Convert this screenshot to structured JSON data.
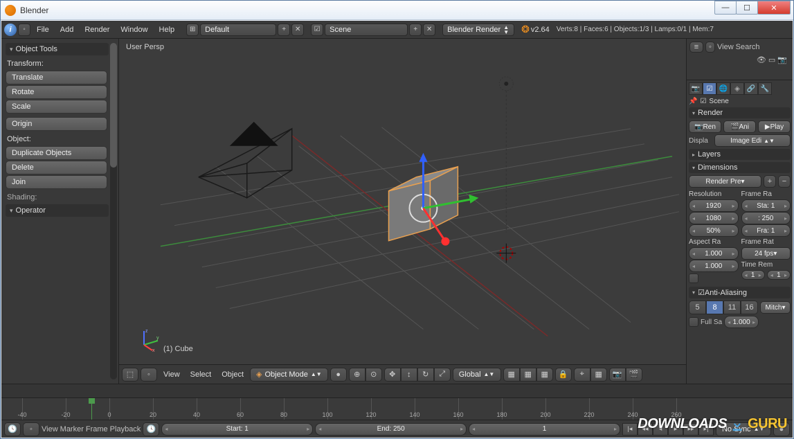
{
  "window": {
    "title": "Blender"
  },
  "menubar": {
    "items": [
      "File",
      "Add",
      "Render",
      "Window",
      "Help"
    ],
    "layout_value": "Default",
    "scene_value": "Scene",
    "engine_value": "Blender Render",
    "version": "v2.64",
    "stats": "Verts:8 | Faces:6 | Objects:1/3 | Lamps:0/1 | Mem:7"
  },
  "toolbox": {
    "header": "Object Tools",
    "transform_label": "Transform:",
    "transform_buttons": [
      "Translate",
      "Rotate",
      "Scale"
    ],
    "origin_button": "Origin",
    "object_label": "Object:",
    "object_buttons": [
      "Duplicate Objects",
      "Delete",
      "Join"
    ],
    "shading_label": "Shading:",
    "operator_header": "Operator"
  },
  "viewport": {
    "persp_label": "User Persp",
    "object_label": "(1) Cube",
    "header": {
      "menus": [
        "View",
        "Select",
        "Object"
      ],
      "mode": "Object Mode",
      "orientation": "Global"
    }
  },
  "outliner": {
    "menus": [
      "View",
      "Search"
    ]
  },
  "props": {
    "context_label": "Scene",
    "render_header": "Render",
    "render_buttons": [
      "Ren",
      "Ani",
      "Play"
    ],
    "display_label": "Displa",
    "display_value": "Image Edi",
    "layers_header": "Layers",
    "dimensions_header": "Dimensions",
    "preset_value": "Render Pre",
    "resolution_label": "Resolution",
    "frame_range_label": "Frame Ra",
    "res_x": "1920",
    "res_y": "1080",
    "res_pct": "50%",
    "frame_start": "Sta: 1",
    "frame_end": ": 250",
    "frame_step": "Fra: 1",
    "aspect_label": "Aspect Ra",
    "frame_rate_label": "Frame Rat",
    "aspect_x": "1.000",
    "fps_value": "24 fps",
    "aspect_y": "1.000",
    "time_label": "Time Rem",
    "aa_header": "Anti-Aliasing",
    "aa_samples": [
      "5",
      "8",
      "11",
      "16"
    ],
    "aa_filter": "Mitch",
    "full_sample": "Full Sa",
    "filter_size": "1.000"
  },
  "timeline": {
    "ticks": [
      "-40",
      "-20",
      "0",
      "20",
      "40",
      "60",
      "80",
      "100",
      "120",
      "140",
      "160",
      "180",
      "200",
      "220",
      "240",
      "260"
    ],
    "menus": [
      "View",
      "Marker",
      "Frame",
      "Playback"
    ],
    "start_label": "Start: 1",
    "end_label": "End: 250",
    "current": "1",
    "sync": "No Sync"
  },
  "watermark": {
    "text1": "DOWNLOADS",
    "text2": "GURU"
  }
}
